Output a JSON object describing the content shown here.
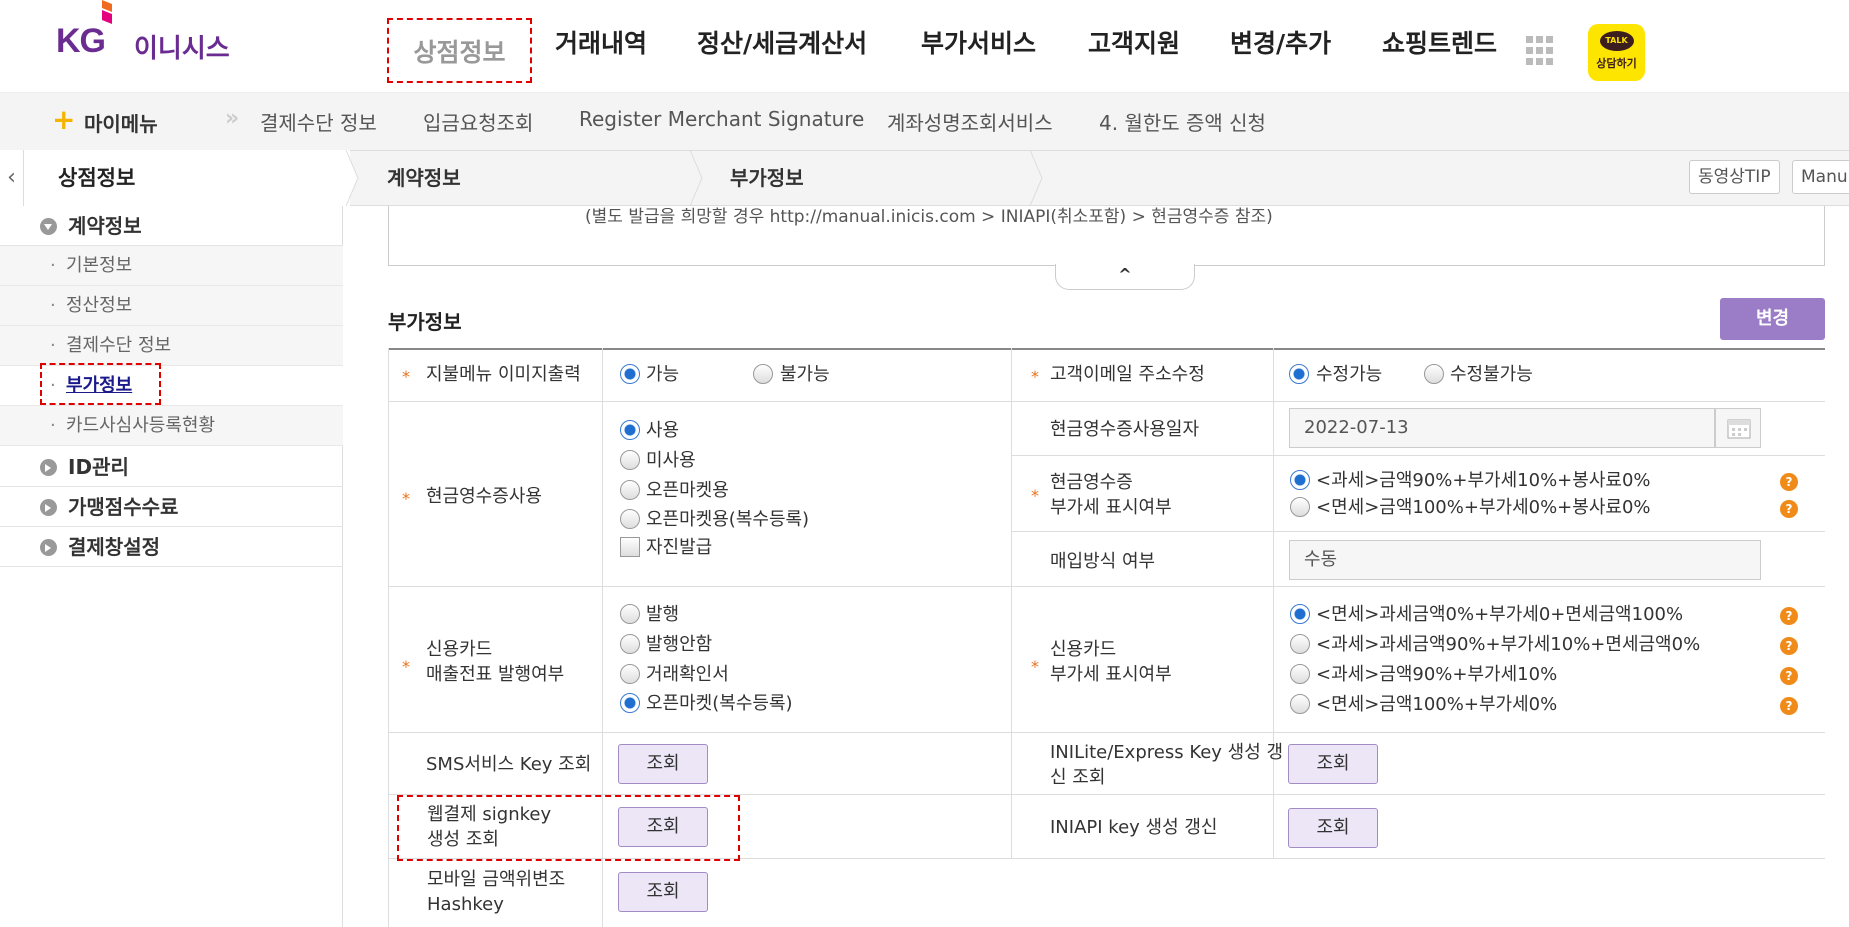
{
  "brand": {
    "kg": "KG",
    "name": "이니시스"
  },
  "gnb": [
    "상점정보",
    "거래내역",
    "정산/세금계산서",
    "부가서비스",
    "고객지원",
    "변경/추가",
    "쇼핑트렌드"
  ],
  "kakao": {
    "top": "TALK",
    "label": "상담하기"
  },
  "mymenu": {
    "label": "마이메뉴",
    "items": [
      "결제수단 정보",
      "입금요청조회",
      "Register Merchant Signature",
      "계좌성명조회서비스",
      "4. 월한도 증액 신청"
    ]
  },
  "tabs": [
    "상점정보",
    "계약정보",
    "부가정보"
  ],
  "tab_buttons": [
    "동영상TIP",
    "Manu"
  ],
  "sidebar": {
    "contract": "계약정보",
    "sub": [
      "기본정보",
      "정산정보",
      "결제수단 정보",
      "부가정보",
      "카드사심사등록현황"
    ],
    "others": [
      "ID관리",
      "가맹점수수료",
      "결제창설정"
    ]
  },
  "notice": "(별도 발급을 희망할 경우 http://manual.inicis.com > INIAPI(취소포함) > 현금영수증 참조)",
  "fold_icon": "^",
  "section": {
    "title": "부가정보",
    "change": "변경"
  },
  "rows": {
    "pay_img": {
      "label": "지불메뉴 이미지출력",
      "opts": [
        "가능",
        "불가능"
      ]
    },
    "email": {
      "label": "고객이메일 주소수정",
      "opts": [
        "수정가능",
        "수정불가능"
      ]
    },
    "cash_use": {
      "label": "현금영수증사용",
      "opts": [
        "사용",
        "미사용",
        "오픈마켓용",
        "오픈마켓용(복수등록)"
      ],
      "chk": "자진발급"
    },
    "cash_date": {
      "label": "현금영수증사용일자",
      "value": "2022-07-13"
    },
    "cash_vat": {
      "label1": "현금영수증",
      "label2": "부가세 표시여부",
      "opts": [
        "<과세>금액90%+부가세10%+봉사료0%",
        "<면세>금액100%+부가세0%+봉사료0%"
      ]
    },
    "purchase": {
      "label": "매입방식 여부",
      "value": "수동"
    },
    "card_slip": {
      "label1": "신용카드",
      "label2": "매출전표 발행여부",
      "opts": [
        "발행",
        "발행안함",
        "거래확인서",
        "오픈마켓(복수등록)"
      ]
    },
    "card_vat": {
      "label1": "신용카드",
      "label2": "부가세 표시여부",
      "opts": [
        "<면세>과세금액0%+부가세0+면세금액100%",
        "<과세>과세금액90%+부가세10%+면세금액0%",
        "<과세>금액90%+부가세10%",
        "<면세>금액100%+부가세0%"
      ]
    },
    "sms": {
      "label": "SMS서비스 Key 조회",
      "btn": "조회"
    },
    "inilite": {
      "label1": "INILite/Express Key  생성 갱",
      "label2": "신 조회",
      "btn": "조회"
    },
    "signkey": {
      "label1": "웹결제 signkey",
      "label2": "생성 조회",
      "btn": "조회"
    },
    "iniapi": {
      "label": "INIAPI key 생성 갱신",
      "btn": "조회"
    },
    "hashkey": {
      "label1": "모바일 금액위변조",
      "label2": "Hashkey",
      "btn": "조회"
    }
  },
  "help_icon": "?",
  "colors": {
    "brand": "#6a2c91",
    "accent": "#9b7dc7",
    "star": "#e8721c",
    "help": "#f08b1a",
    "highlight": "#e00000"
  }
}
